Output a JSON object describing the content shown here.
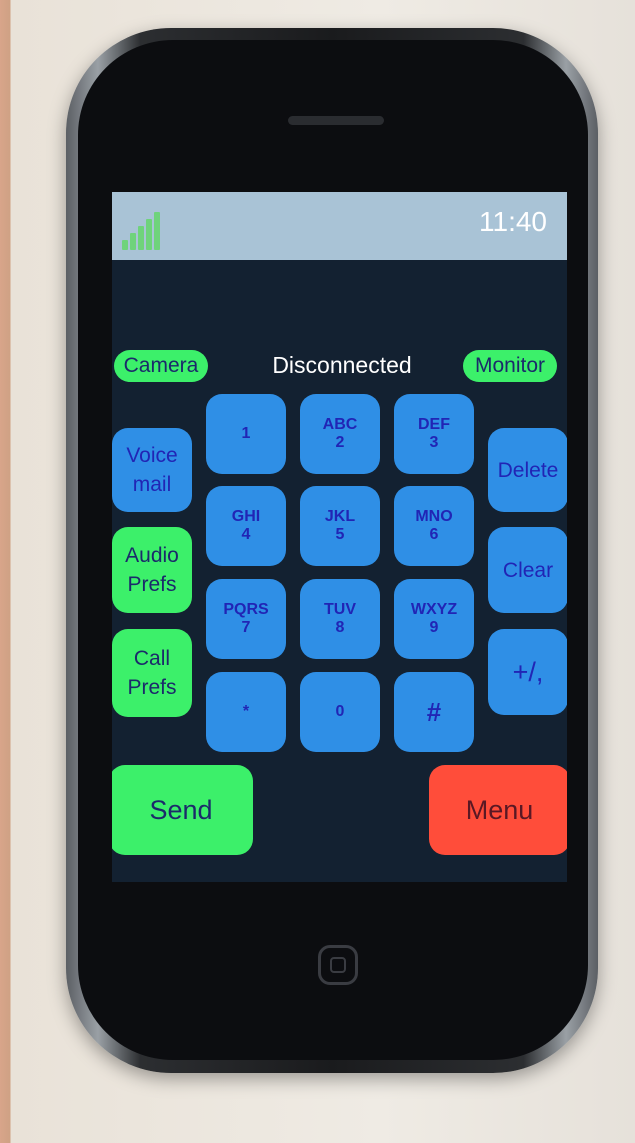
{
  "status_bar": {
    "time": "11:40",
    "signal_icon": "signal-bars-icon"
  },
  "top_row": {
    "camera": "Camera",
    "status": "Disconnected",
    "monitor": "Monitor"
  },
  "keypad": [
    {
      "letters": "",
      "digit": "1"
    },
    {
      "letters": "ABC",
      "digit": "2"
    },
    {
      "letters": "DEF",
      "digit": "3"
    },
    {
      "letters": "GHI",
      "digit": "4"
    },
    {
      "letters": "JKL",
      "digit": "5"
    },
    {
      "letters": "MNO",
      "digit": "6"
    },
    {
      "letters": "PQRS",
      "digit": "7"
    },
    {
      "letters": "TUV",
      "digit": "8"
    },
    {
      "letters": "WXYZ",
      "digit": "9"
    },
    {
      "letters": "",
      "digit": "*"
    },
    {
      "letters": "",
      "digit": "0"
    },
    {
      "letters": "",
      "digit": "#"
    }
  ],
  "left_buttons": {
    "voicemail": [
      "Voice",
      "mail"
    ],
    "audio_prefs": [
      "Audio",
      "Prefs"
    ],
    "call_prefs": [
      "Call",
      "Prefs"
    ]
  },
  "right_buttons": {
    "delete": "Delete",
    "clear": "Clear",
    "plus_comma": "+/,"
  },
  "bottom": {
    "send": "Send",
    "menu": "Menu"
  },
  "colors": {
    "status_bar": "#a9c3d6",
    "screen_bg": "#132131",
    "key_blue": "#2f8fe6",
    "button_green": "#3cf06a",
    "button_red": "#ff4d3a",
    "key_text": "#2125b5"
  }
}
